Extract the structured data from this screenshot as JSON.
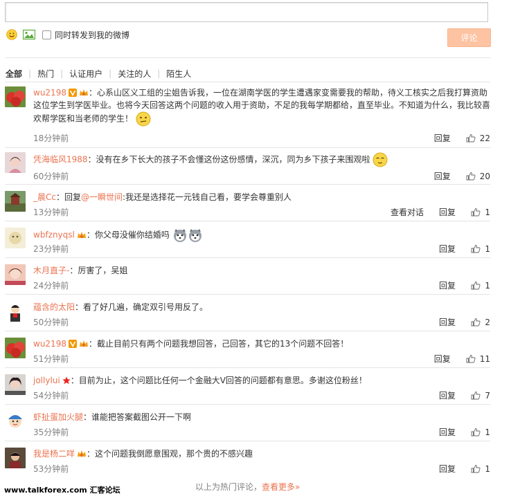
{
  "composer": {
    "placeholder": "",
    "repost_label": "同时转发到我的微博",
    "submit_label": "评论"
  },
  "filters": [
    "全部",
    "热门",
    "认证用户",
    "关注的人",
    "陌生人"
  ],
  "comments": [
    {
      "user": "wu2198",
      "text": "：心系山区义工组的尘姐告诉我，一位在湖南学医的学生遭遇家变需要我的帮助，待义工核实之后我打算资助这位学生到学医毕业。也将今天回答这两个问题的收入用于资助，不足的我每学期都给，直至毕业。不知道为什么，我比较喜欢帮学医和当老师的学生！",
      "time": "18分钟前",
      "reply": "回复",
      "likes": "22"
    },
    {
      "user": "凭海临风1988",
      "text": "：没有在乡下长大的孩子不会懂这份这份感情，深沉，同为乡下孩子来围观啦",
      "time": "60分钟前",
      "reply": "回复",
      "likes": "20"
    },
    {
      "user": "_晨Cc",
      "text_prefix": "：回复",
      "mention": "@一瞬世间",
      "text": ":我还是选择花一元钱自己看，要学会尊重别人",
      "time": "13分钟前",
      "view": "查看对话",
      "reply": "回复",
      "likes": "1"
    },
    {
      "user": "wbfznyqsl",
      "text": "：你父母没催你结婚吗",
      "time": "23分钟前",
      "reply": "回复",
      "likes": "1"
    },
    {
      "user": "木月直子-",
      "text": "：厉害了，吴姐",
      "time": "24分钟前",
      "reply": "回复",
      "likes": "1"
    },
    {
      "user": "蕴含的太阳",
      "text": "：看了好几遍，确定双引号用反了。",
      "time": "50分钟前",
      "reply": "回复",
      "likes": "2"
    },
    {
      "user": "wu2198",
      "text": "：截止目前只有两个问题我想回答，己回答，其它的13个问题不回答！",
      "time": "51分钟前",
      "reply": "回复",
      "likes": "11"
    },
    {
      "user": "jollylui",
      "text": "：目前为止，这个问题比任何一个金融大V回答的问题都有意思。多谢这位粉丝！",
      "time": "54分钟前",
      "reply": "回复",
      "likes": "7"
    },
    {
      "user": "虾扯蛋加火腿",
      "text": "：谁能把答案截图公开一下啊",
      "time": "35分钟前",
      "reply": "回复",
      "likes": "1"
    },
    {
      "user": "我是杨二咩",
      "text": "：这个问题我倒愿意围观，那个贵的不感兴趣",
      "time": "53分钟前",
      "reply": "回复",
      "likes": "1"
    }
  ],
  "footer": {
    "note": "以上为热门评论，",
    "more": "查看更多»"
  },
  "watermark": {
    "domain": "www.talkforex.com",
    "name": "汇客论坛"
  },
  "colors": {
    "accent": "#eb7350",
    "button_bg": "#fdc3a2",
    "muted": "#808080"
  }
}
